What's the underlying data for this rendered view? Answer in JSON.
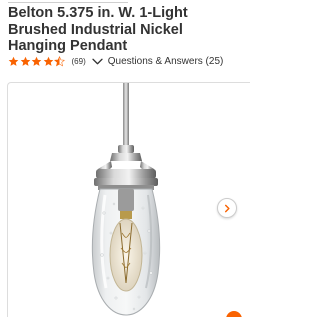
{
  "product": {
    "title": "Belton 5.375 in. W. 1-Light Brushed Industrial Nickel Hanging Pendant",
    "rating": 4.5,
    "rating_max": 5,
    "review_count_label": "(69)",
    "qa_label": "Questions & Answers (25)"
  },
  "gallery": {
    "image_alt": "Belton brushed nickel hanging pendant with clear seeded glass shade and exposed bulb",
    "next_icon": "chevron-right-icon"
  },
  "colors": {
    "brand_orange": "#f96302",
    "title_text": "#333333",
    "frame_border": "#dddddd"
  }
}
